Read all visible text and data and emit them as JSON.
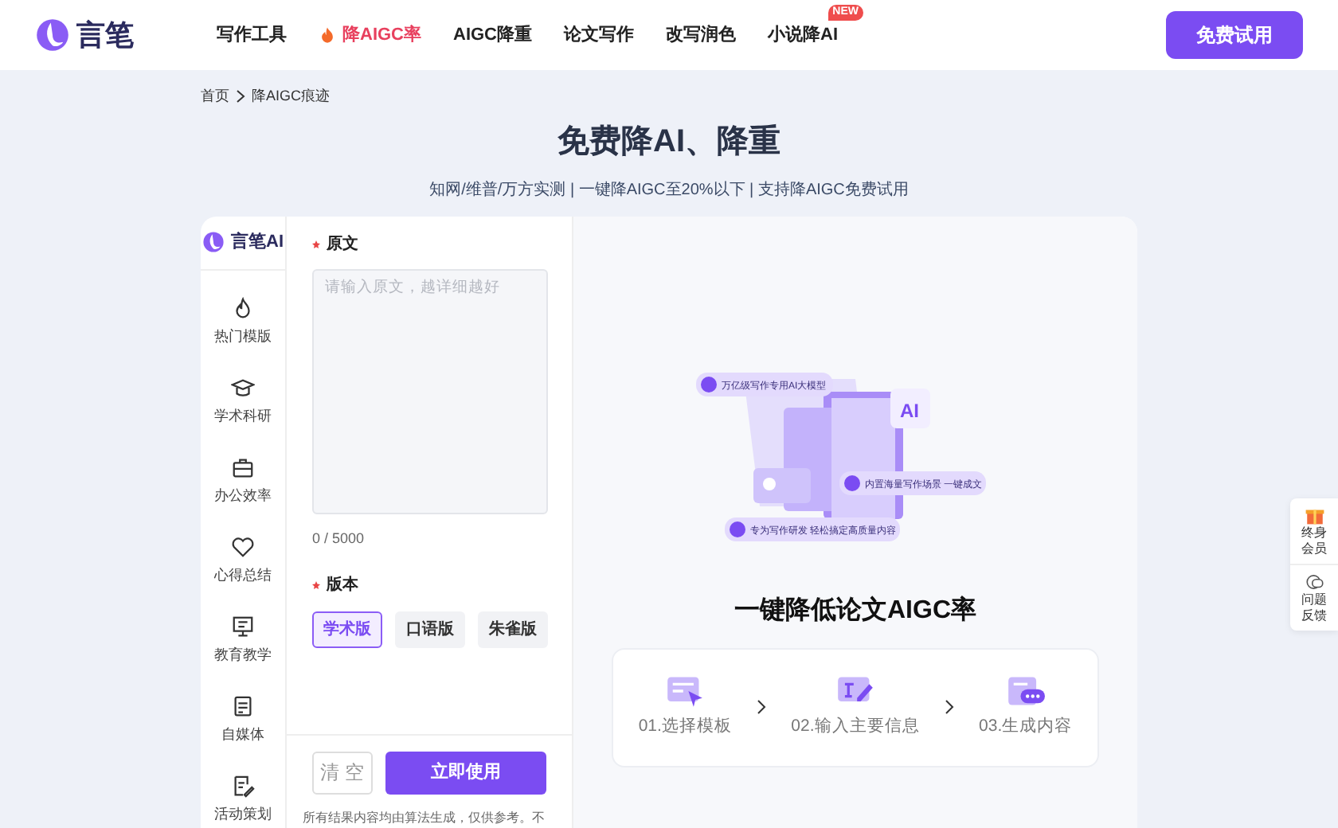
{
  "header": {
    "brand": "言笔",
    "nav": [
      {
        "label": "写作工具",
        "kind": "plain",
        "selected": false
      },
      {
        "label": "降AIGC率",
        "kind": "hot",
        "selected": true
      },
      {
        "label": "AIGC降重",
        "kind": "plain",
        "selected": false
      },
      {
        "label": "论文写作",
        "kind": "plain",
        "selected": false
      },
      {
        "label": "改写润色",
        "kind": "plain",
        "selected": false
      },
      {
        "label": "小说降AI",
        "kind": "badge",
        "badge": "NEW",
        "selected": false
      }
    ],
    "cta": "免费试用"
  },
  "breadcrumb": [
    "首页",
    "降AIGC痕迹"
  ],
  "hero": {
    "title": "免费降AI、降重",
    "subtitle": "知网/维普/万方实测 | 一键降AIGC至20%以下 | 支持降AIGC免费试用"
  },
  "sidebar": {
    "brand": "言笔AI",
    "items": [
      {
        "label": "热门模版"
      },
      {
        "label": "学术科研"
      },
      {
        "label": "办公效率"
      },
      {
        "label": "心得总结"
      },
      {
        "label": "教育教学"
      },
      {
        "label": "自媒体"
      },
      {
        "label": "活动策划"
      }
    ]
  },
  "form": {
    "source_label": "原文",
    "placeholder": "请输入原文，越详细越好",
    "count": "0 / 5000",
    "version_label": "版本",
    "versions": [
      {
        "label": "学术版",
        "selected": true
      },
      {
        "label": "口语版",
        "selected": false
      },
      {
        "label": "朱雀版",
        "selected": false
      }
    ],
    "clear": "清 空",
    "submit": "立即使用",
    "disclaimer": "所有结果内容均由算法生成，仅供参考。不"
  },
  "showcase": {
    "illustration": {
      "badge_top": "万亿级写作专用AI大模型",
      "badge_middle": "内置海量写作场景  一键成文",
      "badge_bottom": "专为写作研发  轻松搞定高质量内容",
      "ai_tile": "AI"
    },
    "title": "一键降低论文AIGC率",
    "steps": [
      {
        "label": "01.选择模板"
      },
      {
        "label": "02.输入主要信息"
      },
      {
        "label": "03.生成内容"
      }
    ]
  },
  "float_panel": [
    {
      "label": "终身会员"
    },
    {
      "label": "问题反馈"
    }
  ]
}
